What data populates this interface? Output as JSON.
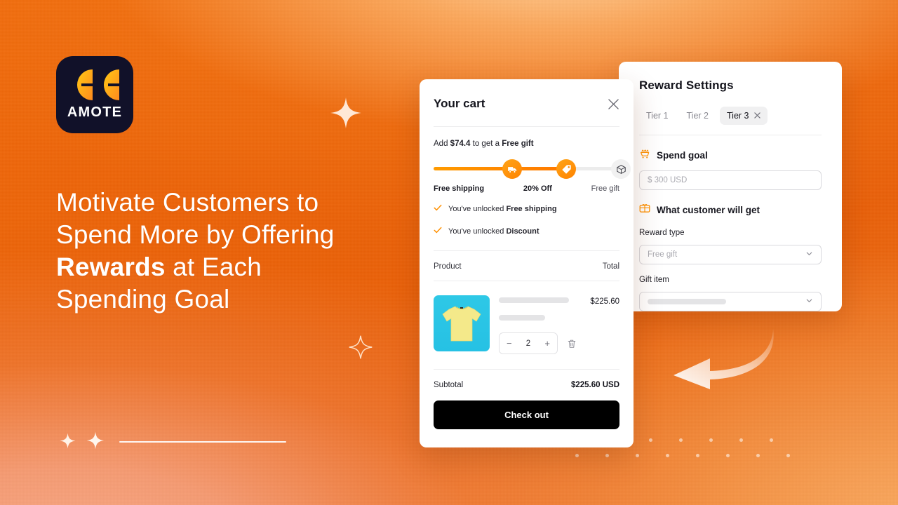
{
  "background": {
    "base_color": "#E8600A",
    "glow_color": "#FFD9A8",
    "accent_color": "#FF8A00"
  },
  "logo": {
    "wordmark": "AMOTE",
    "mark_icon": "quote-marks-icon",
    "badge_color": "#111129",
    "mark_color": "#FFB300"
  },
  "headline": {
    "line1": "Motivate Customers to",
    "line2": "Spend More by Offering",
    "line3_bold": "Rewards",
    "line3_rest": " at Each",
    "line4": "Spending Goal"
  },
  "cart": {
    "title": "Your cart",
    "close_icon": "close-icon",
    "progress_message_prefix": "Add ",
    "progress_message_amount": "$74.4",
    "progress_message_middle": " to get a ",
    "progress_message_reward": "Free gift",
    "progress_fill_percent": 68,
    "milestones": [
      {
        "label": "Free shipping",
        "icon": "truck-icon",
        "unlocked": true
      },
      {
        "label": "20% Off",
        "icon": "price-tag-icon",
        "unlocked": true
      },
      {
        "label": "Free gift",
        "icon": "gift-box-icon",
        "unlocked": false
      }
    ],
    "unlocked_items": [
      {
        "icon": "check-icon",
        "prefix": "You've unlocked ",
        "reward": "Free shipping"
      },
      {
        "icon": "check-icon",
        "prefix": "You've unlocked ",
        "reward": "Discount"
      }
    ],
    "table": {
      "product_header": "Product",
      "total_header": "Total"
    },
    "product": {
      "image_icon": "tshirt-image",
      "price": "$225.60",
      "quantity": "2",
      "decrease_label": "−",
      "increase_label": "+",
      "remove_icon": "trash-icon"
    },
    "subtotal_label": "Subtotal",
    "subtotal_value": "$225.60 USD",
    "checkout_label": "Check out"
  },
  "reward_settings": {
    "title": "Reward Settings",
    "tiers": [
      {
        "label": "Tier 1",
        "active": false
      },
      {
        "label": "Tier 2",
        "active": false
      },
      {
        "label": "Tier 3",
        "active": true,
        "close_icon": "close-icon"
      }
    ],
    "spend_goal": {
      "icon": "cart-crown-icon",
      "label": "Spend goal",
      "placeholder": "$ 300 USD",
      "value": ""
    },
    "customer_get": {
      "icon": "gift-card-icon",
      "label": "What customer will get"
    },
    "reward_type": {
      "label": "Reward type",
      "value": "Free gift",
      "chevron_icon": "chevron-down-icon"
    },
    "gift_item": {
      "label": "Gift item",
      "value": "",
      "chevron_icon": "chevron-down-icon"
    }
  },
  "decorations": {
    "arrow_icon": "curved-arrow-left-icon",
    "sparkle_icon": "sparkle-icon",
    "dot_grid_icon": "dot-grid"
  }
}
